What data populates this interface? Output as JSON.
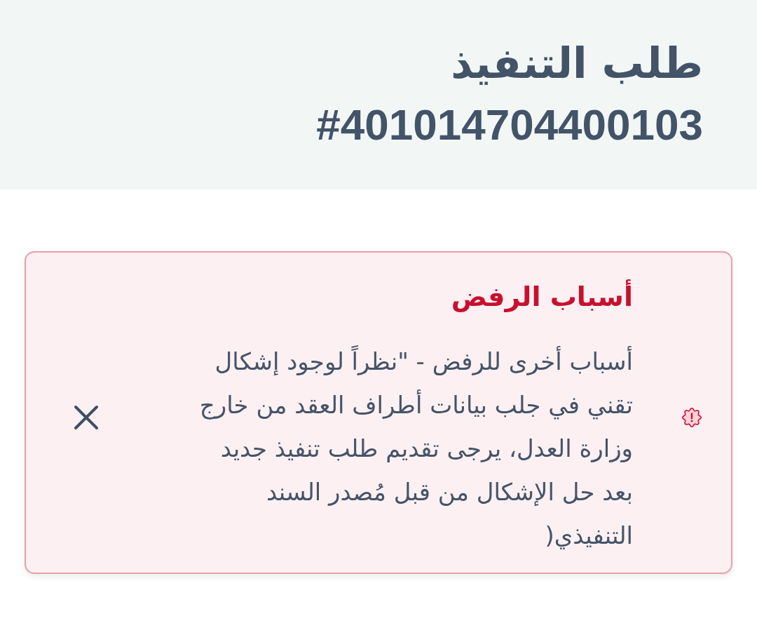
{
  "header": {
    "title": "طلب التنفيذ",
    "request_number": "#401014704400103"
  },
  "alert": {
    "kind": "error",
    "title": "أسباب الرفض",
    "message": "أسباب أخرى للرفض - \"نظراً لوجود إشكال تقني في جلب بيانات أطراف العقد من خارج وزارة العدل، يرجى تقديم طلب تنفيذ جديد بعد حل الإشكال من قبل مُصدر السند التنفيذي("
  }
}
